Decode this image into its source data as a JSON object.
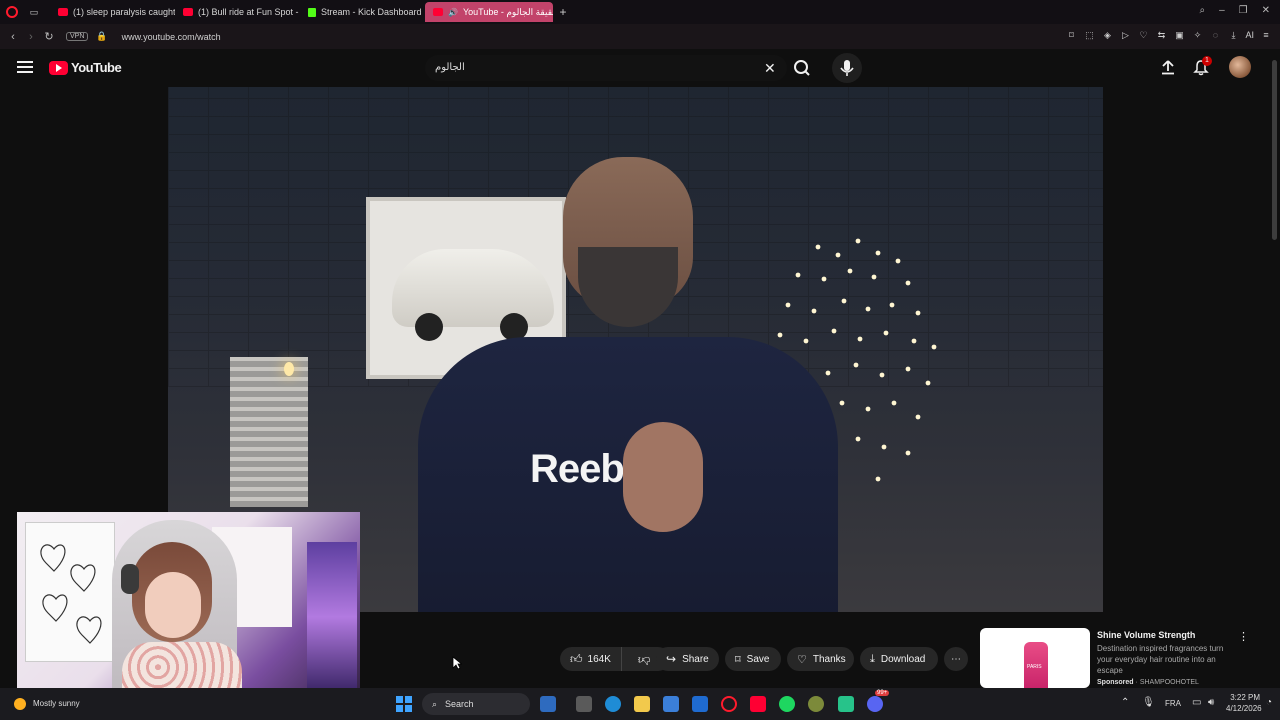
{
  "browser": {
    "tabs": [
      {
        "label": "(1) sleep paralysis caught",
        "favicon": "youtube-icon",
        "active": false
      },
      {
        "label": "(1) Bull ride at Fun Spot - Y",
        "favicon": "youtube-icon",
        "active": false
      },
      {
        "label": "Stream - Kick Dashboard",
        "favicon": "kick-icon",
        "active": false
      },
      {
        "label": "(1) حقيقة الجالوم - YouTube",
        "favicon": "youtube-icon",
        "active": true
      }
    ],
    "vpn_label": "VPN",
    "url": "www.youtube.com/watch",
    "ai_label": "AI"
  },
  "youtube": {
    "logo_text": "YouTube",
    "search_value": "الجالوم",
    "notification_count": "1"
  },
  "actions": {
    "like_count": "164K",
    "share_label": "Share",
    "save_label": "Save",
    "thanks_label": "Thanks",
    "download_label": "Download"
  },
  "ad": {
    "title": "Shine Volume Strength",
    "description": "Destination inspired fragrances turn your everyday hair routine into an escape",
    "sponsored_label": "Sponsored",
    "advertiser": "SHAMPOOHOTEL",
    "thumb_text": "PARIS"
  },
  "video": {
    "shirt_text": "Reebok"
  },
  "taskbar": {
    "weather": "Mostly sunny",
    "search_label": "Search",
    "language": "FRA",
    "time": "3:22 PM",
    "date": "4/12/2026",
    "discord_badge": "99+"
  },
  "colors": {
    "youtube_red": "#ff0033",
    "active_tab": "#c2436a",
    "opera_red": "#ff1b2d",
    "kick_green": "#53fc18"
  }
}
